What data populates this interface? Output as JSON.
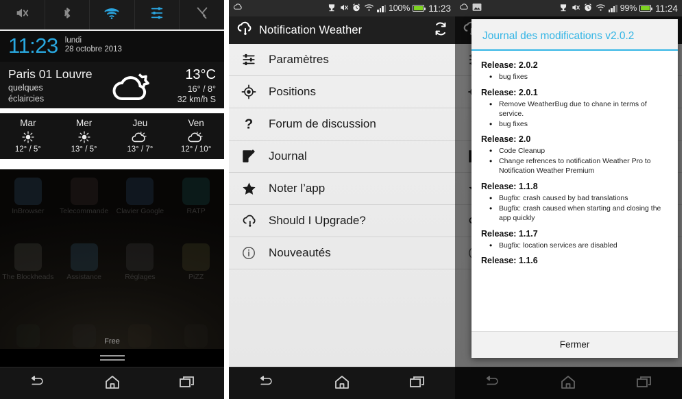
{
  "panel1": {
    "quick_toggles": [
      {
        "name": "sound-mute-icon",
        "state": "off"
      },
      {
        "name": "bluetooth-icon",
        "state": "off"
      },
      {
        "name": "wifi-icon",
        "state": "on"
      },
      {
        "name": "settings-sliders-icon",
        "state": "on"
      },
      {
        "name": "tools-icon",
        "state": "off"
      }
    ],
    "clock": {
      "time": "11:23",
      "day": "lundi",
      "date": "28 octobre 2013"
    },
    "weather": {
      "city": "Paris 01 Louvre",
      "description_line1": "quelques",
      "description_line2": "éclaircies",
      "temp": "13°C",
      "high_low": "16° / 8°",
      "wind": "32 km/h S",
      "icon": "partly-cloudy-icon"
    },
    "forecast": [
      {
        "day": "Mar",
        "icon": "sun-icon",
        "temps": "12° / 5°"
      },
      {
        "day": "Mer",
        "icon": "sun-icon",
        "temps": "13° / 5°"
      },
      {
        "day": "Jeu",
        "icon": "sun-cloud-icon",
        "temps": "13° / 7°"
      },
      {
        "day": "Ven",
        "icon": "sun-cloud-icon",
        "temps": "12° / 10°"
      }
    ],
    "home_apps_row1": [
      {
        "label": "InBrowser",
        "color": "#2e4a63"
      },
      {
        "label": "Telecommande",
        "color": "#3a2a2a"
      },
      {
        "label": "Clavier Google",
        "color": "#27405c"
      },
      {
        "label": "RATP",
        "color": "#16494a"
      }
    ],
    "home_apps_row2": [
      {
        "label": "The Blockheads",
        "color": "#4a4a42"
      },
      {
        "label": "Assistance",
        "color": "#2f4f63"
      },
      {
        "label": "Réglages",
        "color": "#3d3d3d"
      },
      {
        "label": "PiZZ",
        "color": "#4a4428"
      }
    ],
    "dock_apps": [
      {
        "label": "phone",
        "color": "#2f4a38"
      },
      {
        "label": "messaging",
        "color": "#3a3a44"
      },
      {
        "label": "chrome",
        "color": "#4a3a2e"
      },
      {
        "label": "play-store",
        "color": "#3e3a33"
      }
    ],
    "carrier_label": "Free",
    "drawer_handle": "app-drawer-handle"
  },
  "status_bar_2": {
    "battery_pct": "100%",
    "time": "11:23"
  },
  "status_bar_3": {
    "battery_pct": "99%",
    "time": "11:24"
  },
  "panel2": {
    "app_title": "Notification Weather",
    "refresh_icon": "refresh-icon",
    "logo_icon": "cloud-drop-icon",
    "menu": [
      {
        "label": "Paramètres",
        "icon": "sliders-icon"
      },
      {
        "label": "Positions",
        "icon": "location-target-icon"
      },
      {
        "label": "Forum de discussion",
        "icon": "question-mark-icon"
      },
      {
        "label": "Journal",
        "icon": "edit-note-icon"
      },
      {
        "label": "Noter l’app",
        "icon": "star-icon"
      },
      {
        "label": "Should I Upgrade?",
        "icon": "cloud-drop-icon"
      },
      {
        "label": "Nouveautés",
        "icon": "info-circle-icon"
      }
    ]
  },
  "panel3": {
    "dialog_title": "Journal des modifications v2.0.2",
    "close_button": "Fermer",
    "releases": [
      {
        "heading": "Release: 2.0.2",
        "items": [
          "bug fixes"
        ]
      },
      {
        "heading": "Release: 2.0.1",
        "items": [
          "Remove WeatherBug due to chane in terms of service.",
          "bug fixes"
        ]
      },
      {
        "heading": "Release: 2.0",
        "items": [
          "Code Cleanup",
          "Change refrences to notification Weather Pro to Notification Weather Premium"
        ]
      },
      {
        "heading": "Release: 1.1.8",
        "items": [
          "Bugfix: crash caused by bad translations",
          "Bugfix: crash caused when starting and closing the app quickly"
        ]
      },
      {
        "heading": "Release: 1.1.7",
        "items": [
          "Bugfix: location services are disabled"
        ]
      },
      {
        "heading": "Release: 1.1.6",
        "items": []
      }
    ]
  },
  "navbar": {
    "back": "back-icon",
    "home": "home-icon",
    "recents": "recents-icon"
  },
  "colors": {
    "accent": "#33b5e5",
    "clock_blue": "#29a8e0",
    "battery_green": "#7ed321"
  }
}
